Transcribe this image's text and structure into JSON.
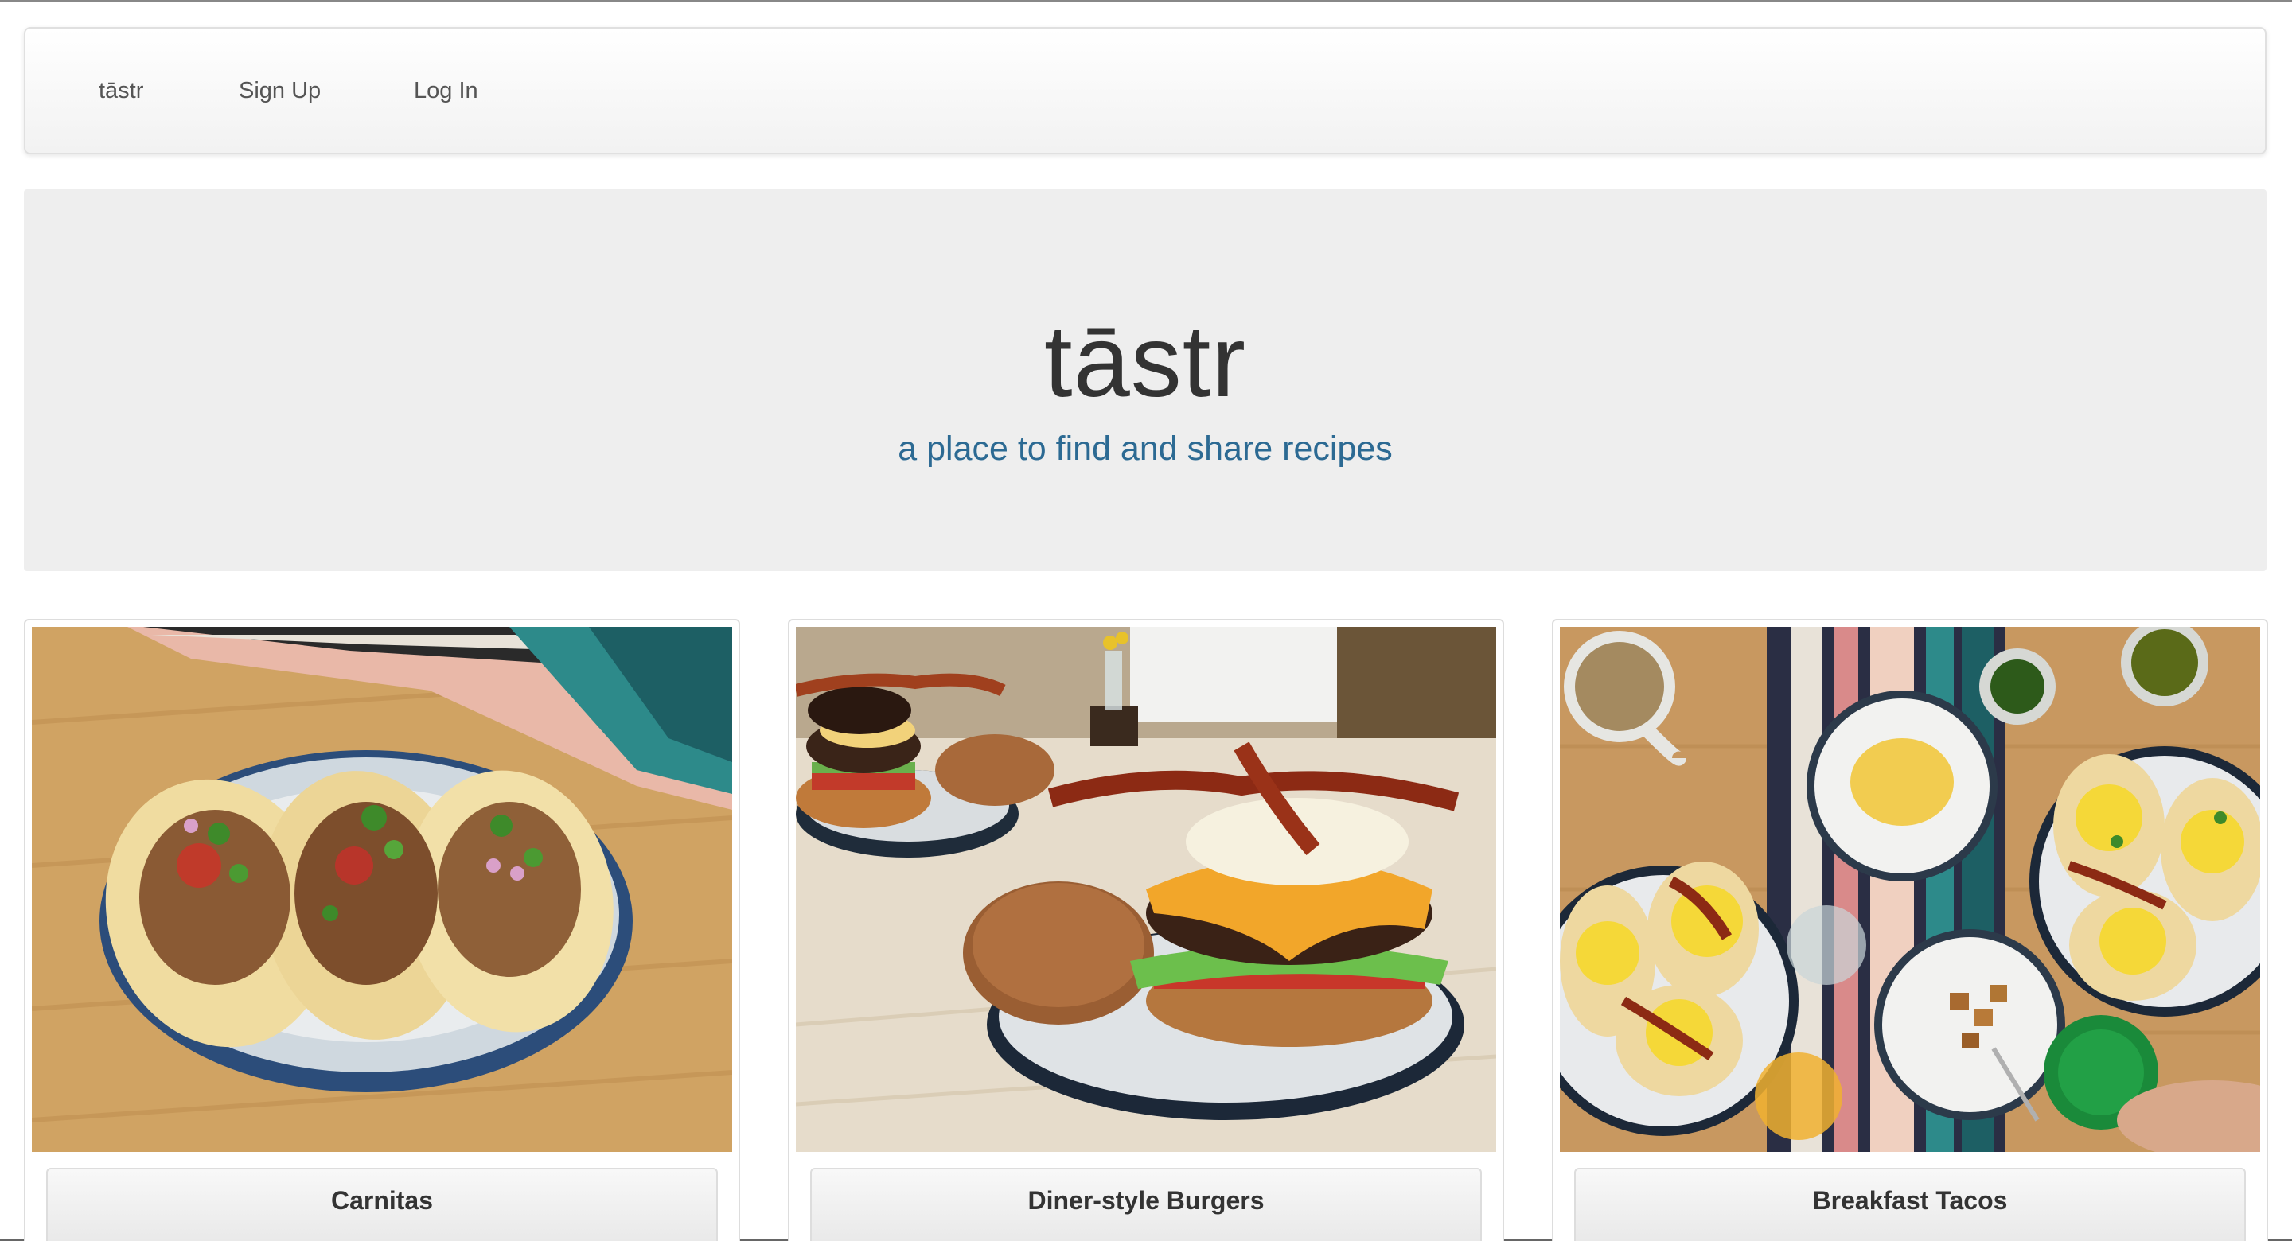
{
  "navbar": {
    "brand": "tāstr",
    "links": [
      {
        "label": "Sign Up"
      },
      {
        "label": "Log In"
      }
    ]
  },
  "jumbotron": {
    "title": "tāstr",
    "tagline": "a place to find and share recipes"
  },
  "recipes": [
    {
      "title": "Carnitas",
      "image": "tacos-photo"
    },
    {
      "title": "Diner-style Burgers",
      "image": "burger-photo"
    },
    {
      "title": "Breakfast Tacos",
      "image": "breakfast-tacos-photo"
    }
  ],
  "colors": {
    "tagline": "#2c6a93",
    "jumbotron_bg": "#eeeeee",
    "title": "#333333"
  }
}
